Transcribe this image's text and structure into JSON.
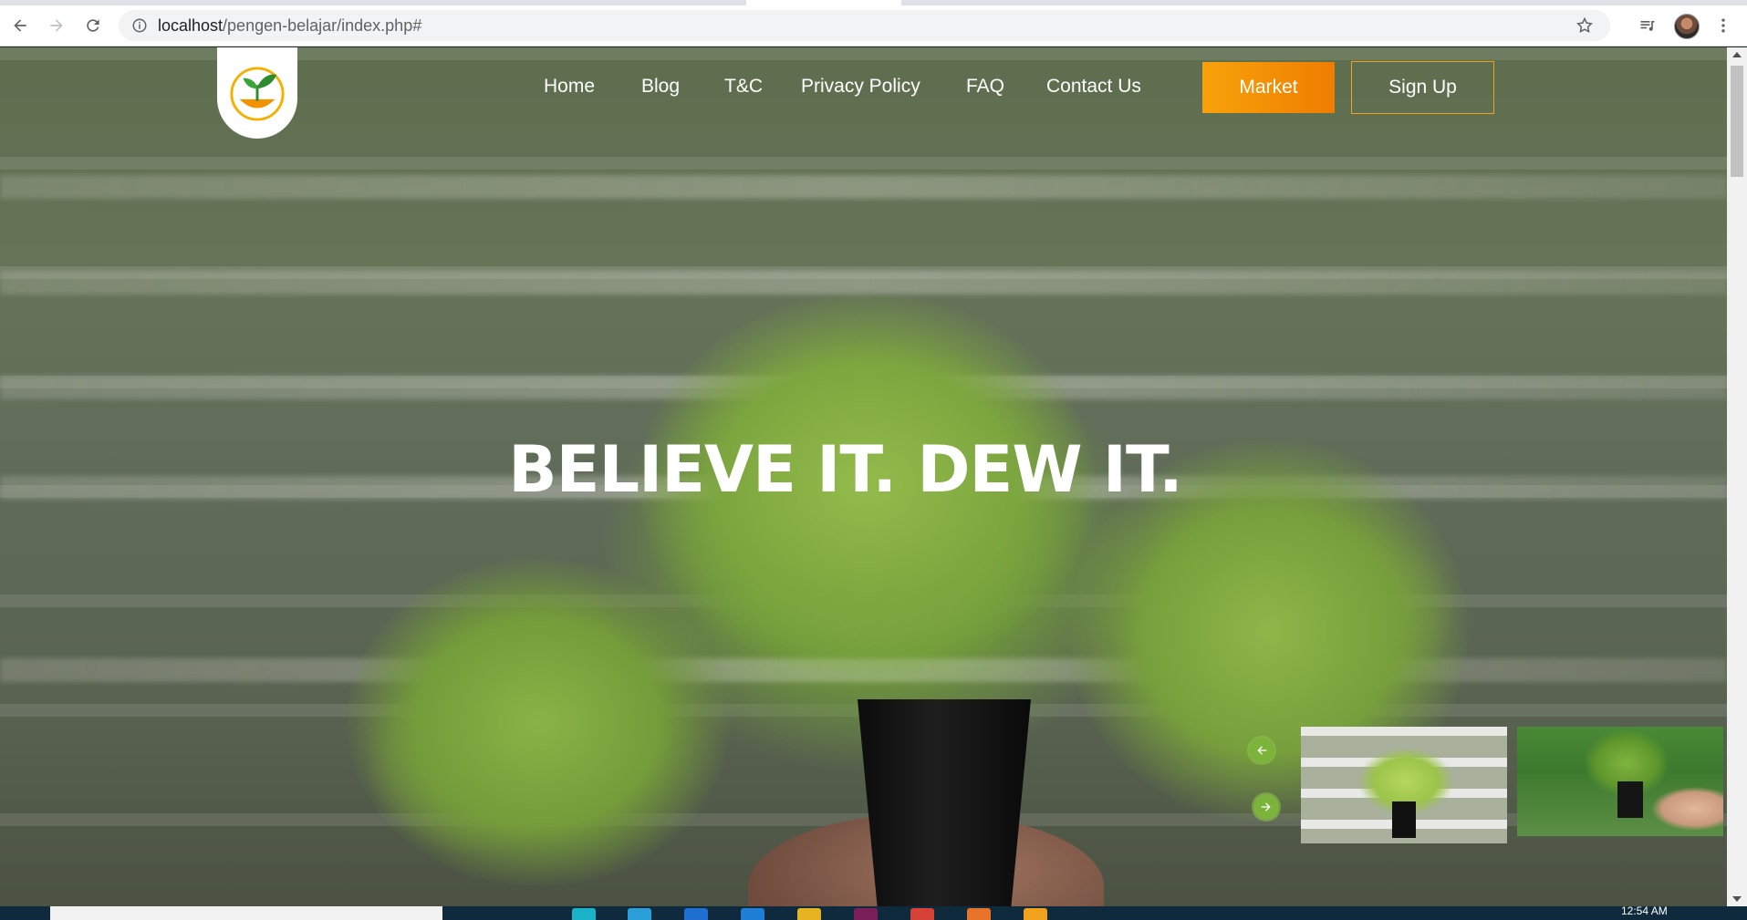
{
  "browser": {
    "url_host": "localhost",
    "url_path": "/pengen-belajar/index.php#"
  },
  "nav": {
    "items": [
      {
        "label": "Home"
      },
      {
        "label": "Blog"
      },
      {
        "label": "T&C"
      },
      {
        "label": "Privacy Policy"
      },
      {
        "label": "FAQ"
      },
      {
        "label": "Contact Us"
      }
    ],
    "market_label": "Market",
    "signup_label": "Sign Up"
  },
  "hero": {
    "headline": "BELIEVE IT. DEW IT."
  },
  "taskbar": {
    "clock": "12:54 AM"
  },
  "colors": {
    "accent_orange": "#f39200",
    "slider_green": "#7bb33b",
    "nav_text": "#ffffff"
  },
  "icons": [
    "back-arrow-icon",
    "forward-arrow-icon",
    "reload-icon",
    "info-icon",
    "star-icon",
    "media-queue-icon",
    "kebab-menu-icon",
    "sprout-logo-icon",
    "arrow-left-icon",
    "arrow-right-icon"
  ]
}
